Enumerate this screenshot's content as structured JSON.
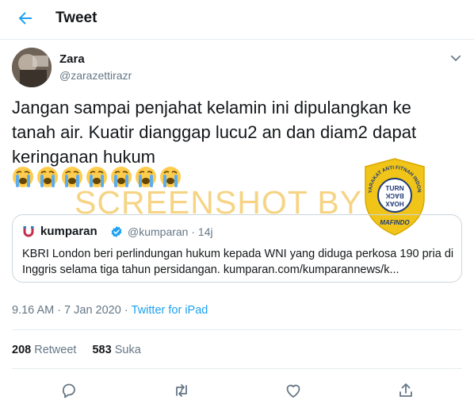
{
  "header": {
    "title": "Tweet",
    "back_icon": "arrow-left-icon"
  },
  "tweet": {
    "author": {
      "name": "Zara",
      "handle": "@zarazettirazr"
    },
    "text": "Jangan sampai penjahat kelamin ini dipulangkan ke tanah air. Kuatir dianggap lucu2 an dan diam2 dapat keringanan hukum",
    "emoji_count": 7,
    "emoji": "loudly-crying-face",
    "quoted": {
      "name": "kumparan",
      "handle": "@kumparan · 14j",
      "text": "KBRI London beri perlindungan hukum kepada WNI yang diduga perkosa 190 pria di Inggris selama tiga tahun persidangan. kumparan.com/kumparannews/k..."
    },
    "time": "9.16 AM",
    "date": "7 Jan 2020",
    "source": "Twitter for iPad",
    "retweets_count": "208",
    "retweets_label": "Retweet",
    "likes_count": "583",
    "likes_label": "Suka"
  },
  "overlay": {
    "watermark": "SCREENSHOT BY",
    "logo_ring_text": "MASYARAKAT ANTI FITNAH INDONESIA",
    "logo_center_top": "TURN",
    "logo_center_mid": "BACK",
    "logo_center_bottom": "HOAX",
    "logo_bottom": "MAFINDO"
  },
  "actions": [
    "reply-icon",
    "retweet-icon",
    "like-icon",
    "share-icon"
  ],
  "colors": {
    "accent": "#1da1f2",
    "secondary_text": "#657786",
    "border": "#e6ecf0",
    "watermark": "#f5cd6e",
    "logo_gold": "#f0c419",
    "logo_navy": "#1f3a78"
  }
}
